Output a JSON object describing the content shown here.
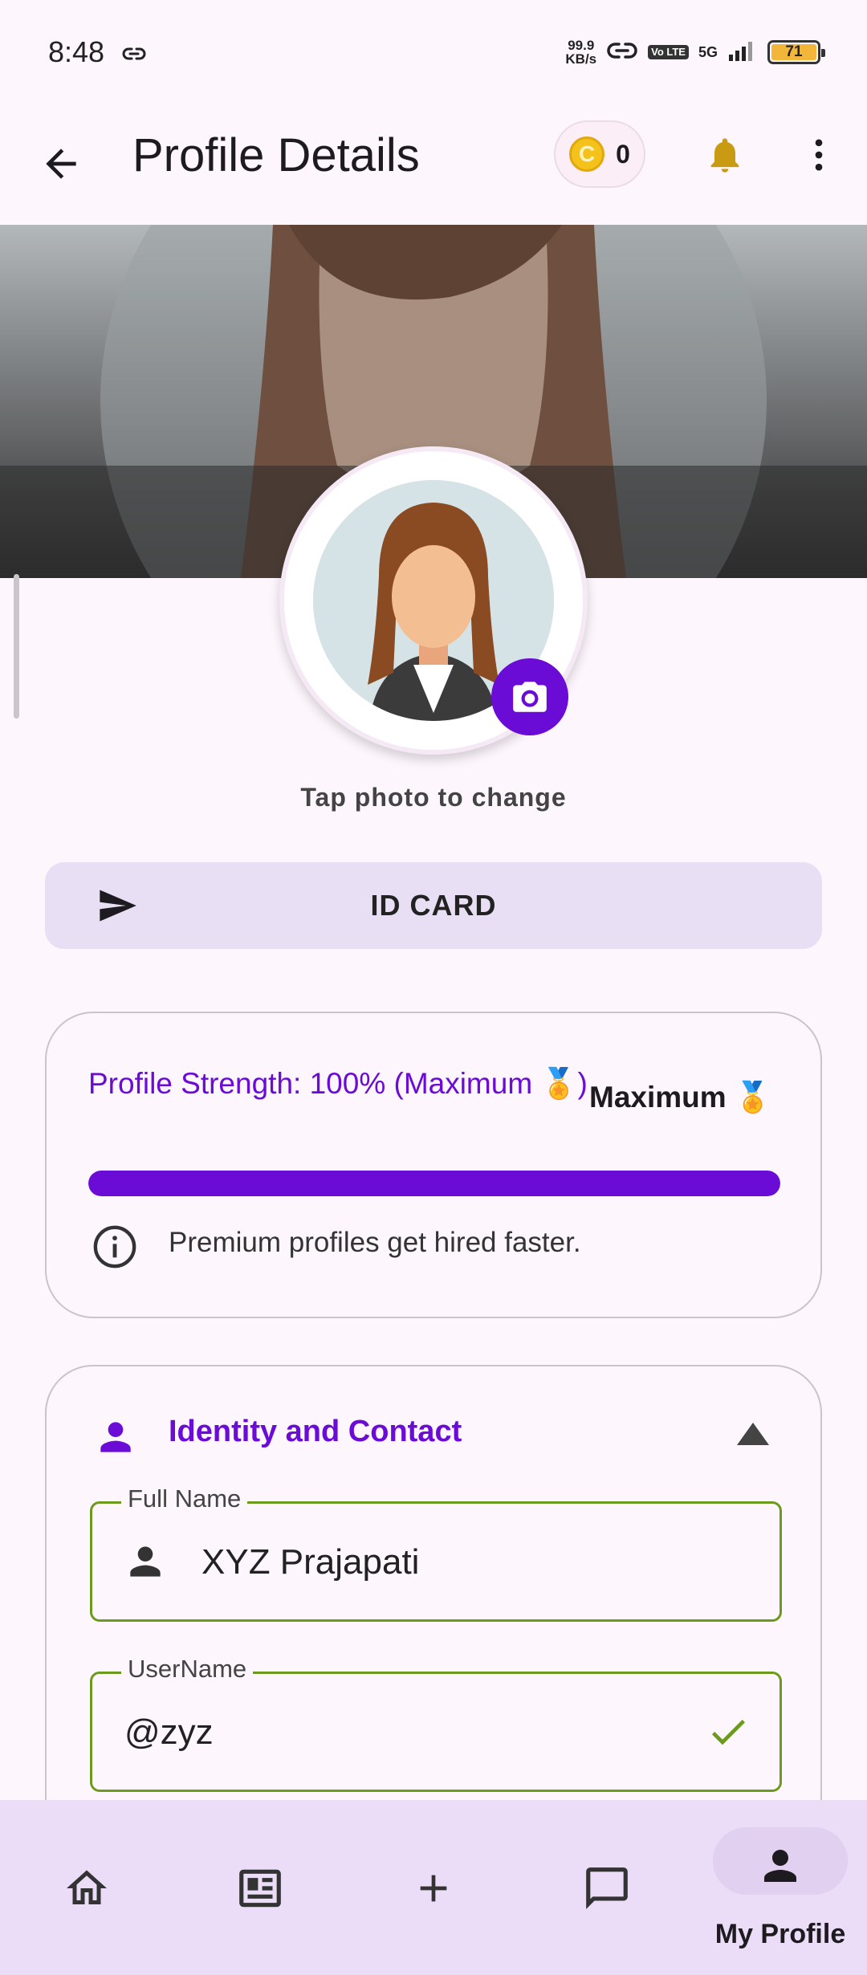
{
  "status_bar": {
    "time": "8:48",
    "net_speed_value": "99.9",
    "net_speed_unit": "KB/s",
    "volte": "Vo LTE",
    "network": "5G",
    "battery": "71"
  },
  "app_bar": {
    "title": "Profile Details",
    "coin_symbol": "C",
    "coin_count": "0"
  },
  "profile": {
    "tap_hint": "Tap photo to change",
    "id_card_label": "ID CARD"
  },
  "strength": {
    "title": "Profile Strength: 100% (Maximum 🏅)",
    "badge": "Maximum 🏅",
    "progress": 1.0,
    "tip": "Premium profiles get hired faster."
  },
  "identity": {
    "title": "Identity and Contact",
    "fields": [
      {
        "label": "Full Name",
        "value": "XYZ Prajapati"
      },
      {
        "label": "UserName",
        "value": "@zyz"
      }
    ]
  },
  "bottom_nav": {
    "items": [
      {
        "icon": "home-icon",
        "label": ""
      },
      {
        "icon": "feed-icon",
        "label": ""
      },
      {
        "icon": "add-icon",
        "label": ""
      },
      {
        "icon": "chat-icon",
        "label": ""
      },
      {
        "icon": "person-icon",
        "label": "My Profile"
      }
    ]
  },
  "colors": {
    "accent": "#6a0bd6",
    "field_border": "#6b9a1d",
    "nav_bg": "#ebdcf7",
    "background": "#fdf7fd"
  }
}
